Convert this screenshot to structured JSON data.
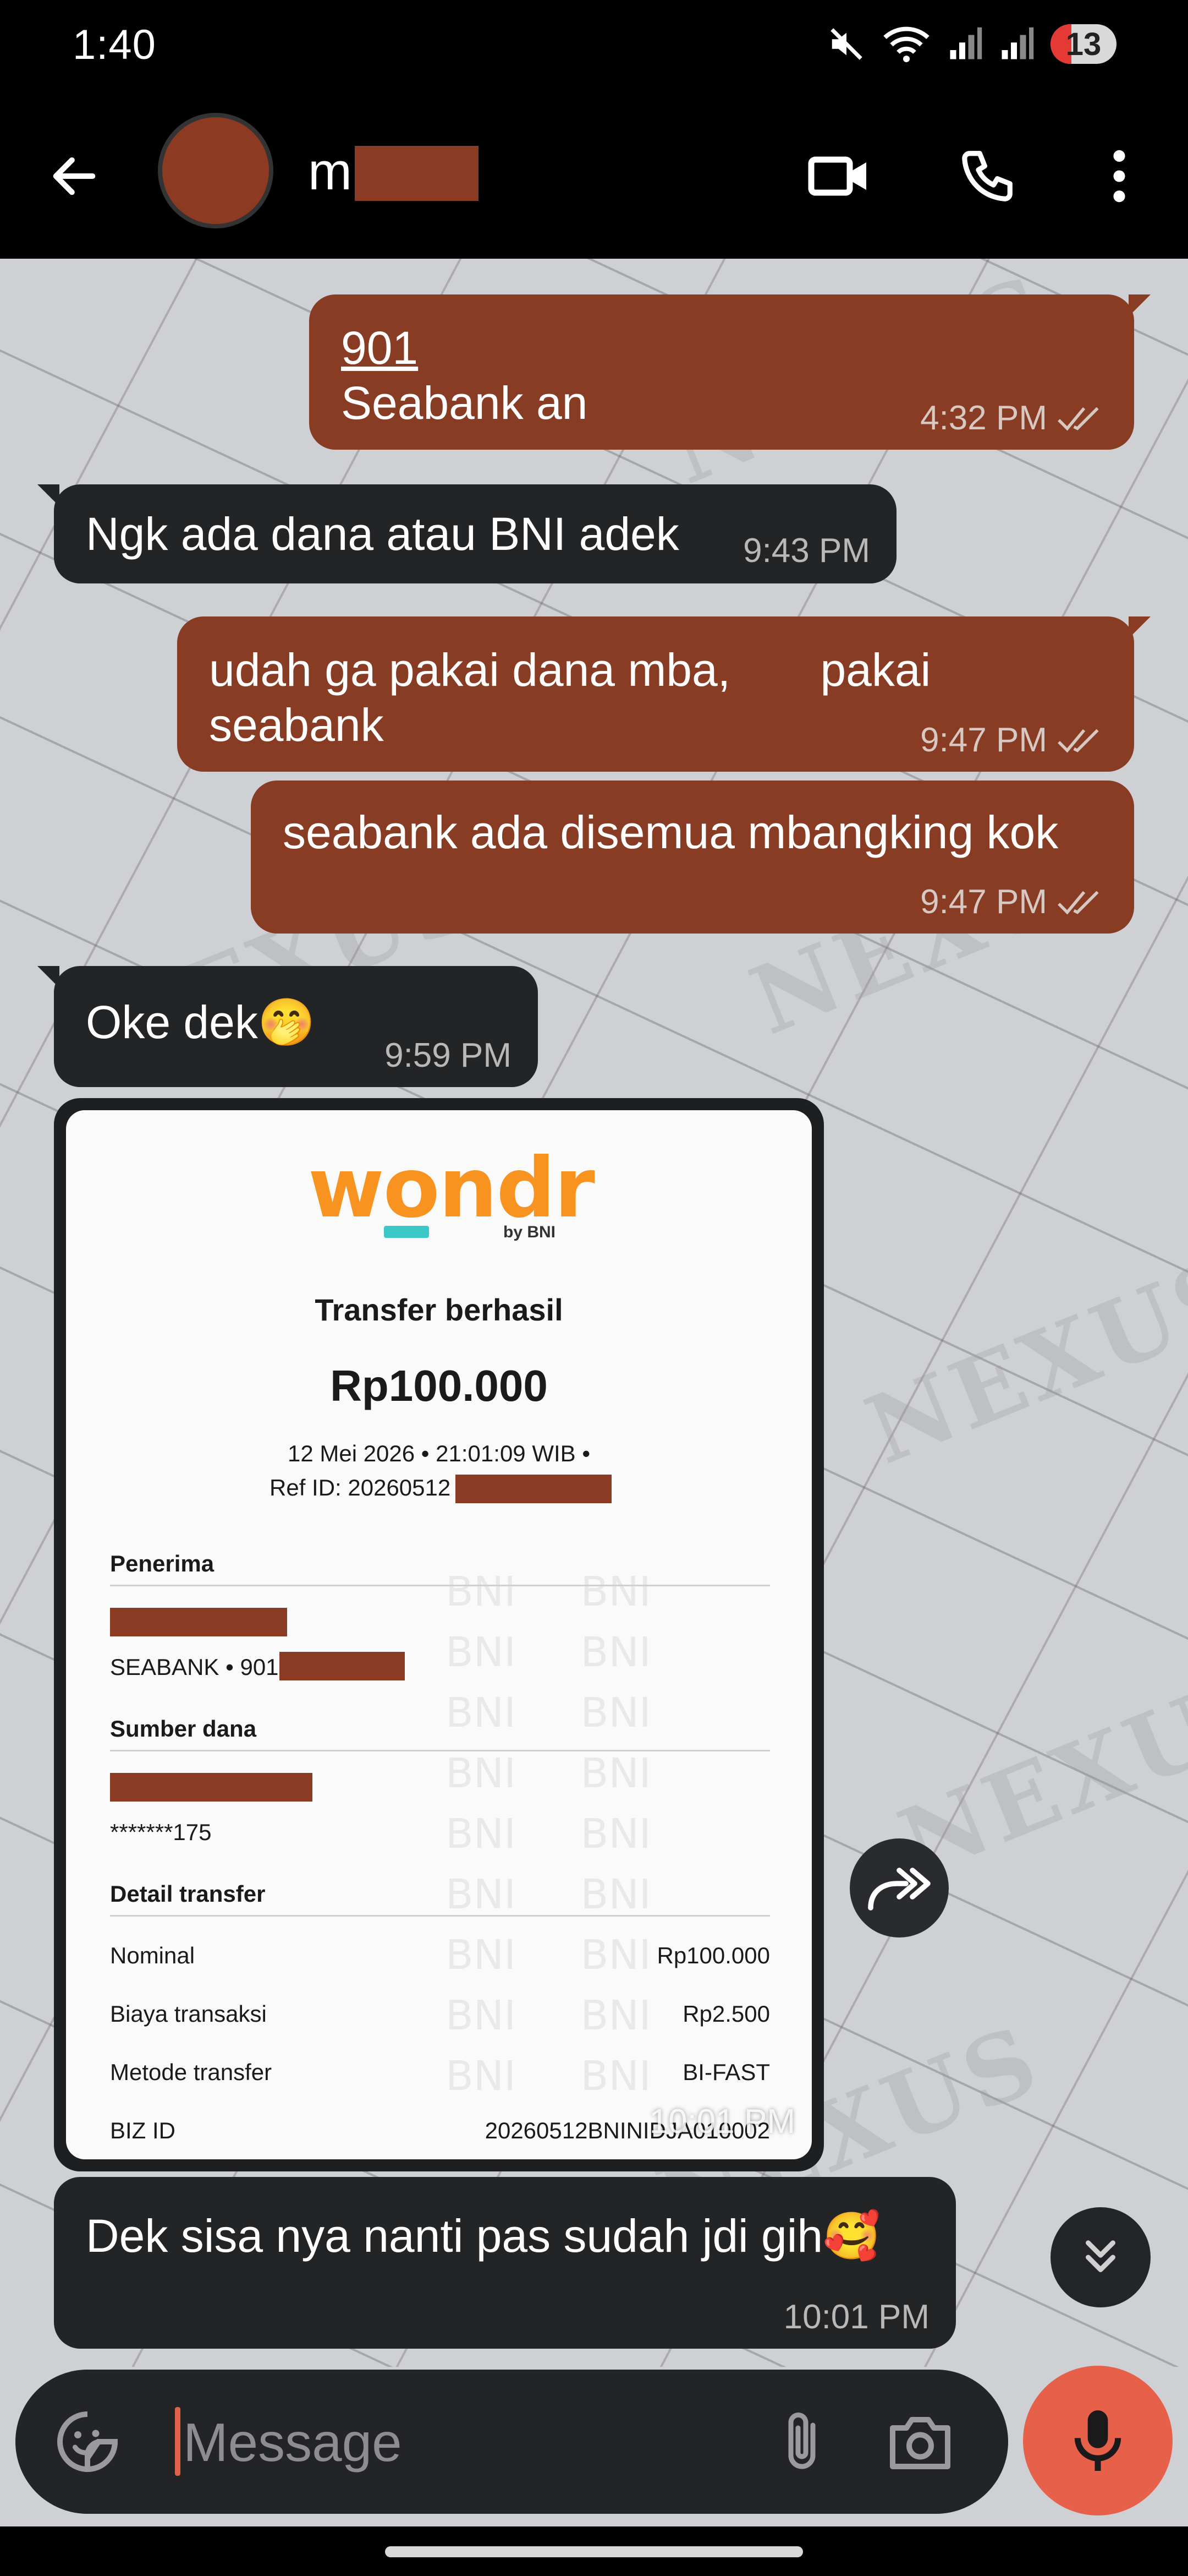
{
  "status_bar": {
    "time": "1:40",
    "battery_level": "13",
    "icons": [
      "mute-icon",
      "wifi-icon",
      "signal-icon",
      "signal-icon"
    ]
  },
  "header": {
    "contact_initial": "m",
    "contact_name_redacted": true,
    "avatar_color": "#8c3a22",
    "actions": [
      "video-call-icon",
      "call-icon",
      "more-icon"
    ]
  },
  "messages": [
    {
      "id": 1,
      "direction": "out",
      "lines": [
        "901",
        "Seabank an"
      ],
      "time": "4:32 PM",
      "read": true
    },
    {
      "id": 2,
      "direction": "in",
      "lines": [
        "Ngk ada dana atau BNI adek"
      ],
      "time": "9:43 PM"
    },
    {
      "id": 3,
      "direction": "out",
      "lines": [
        "udah ga pakai dana mba,       pakai",
        "seabank"
      ],
      "time": "9:47 PM",
      "read": true
    },
    {
      "id": 4,
      "direction": "out",
      "lines": [
        "seabank ada disemua mbangking kok"
      ],
      "time": "9:47 PM",
      "read": true
    },
    {
      "id": 5,
      "direction": "in",
      "lines": [
        "Oke dek🤭"
      ],
      "time": "9:59 PM"
    },
    {
      "id": 6,
      "direction": "in",
      "type": "image",
      "time": "10:01 PM"
    },
    {
      "id": 7,
      "direction": "in",
      "lines": [
        "Dek sisa nya nanti pas sudah jdi gih🥰"
      ],
      "time": "10:01 PM"
    }
  ],
  "receipt": {
    "brand": "wondr",
    "brand_by": "by BNI",
    "title": "Transfer berhasil",
    "amount": "Rp100.000",
    "datetime": "12 Mei 2026 • 21:01:09 WIB •",
    "ref_label": "Ref ID: 20260512",
    "section_recipient": "Penerima",
    "recipient_bank": "SEABANK • 901",
    "section_source": "Sumber dana",
    "source_account": "*******175",
    "section_detail": "Detail transfer",
    "rows": [
      {
        "label": "Nominal",
        "value": "Rp100.000"
      },
      {
        "label": "Biaya transaksi",
        "value": "Rp2.500"
      },
      {
        "label": "Metode transfer",
        "value": "BI-FAST"
      },
      {
        "label": "BIZ ID",
        "value": "20260512BNINIDJA010002"
      }
    ],
    "watermark": "BNI"
  },
  "chat_watermark": "NEXUS",
  "composer": {
    "placeholder": "Message"
  },
  "colors": {
    "outgoing_bubble": "#883c24",
    "incoming_bubble": "#232426",
    "mic_button": "#e6604a",
    "redaction": "#8b3a24"
  }
}
